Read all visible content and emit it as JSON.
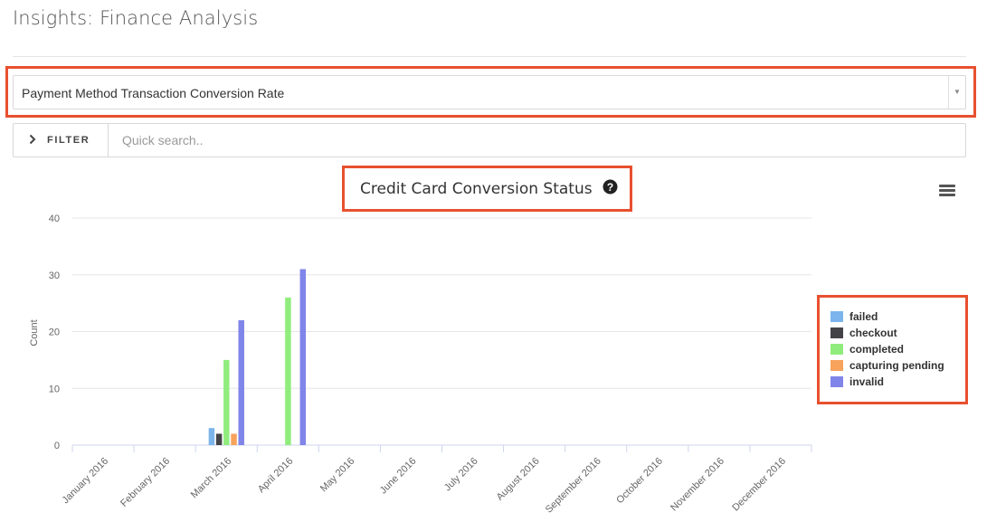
{
  "page": {
    "title": "Insights: Finance Analysis"
  },
  "report_select": {
    "selected": "Payment Method Transaction Conversion Rate"
  },
  "filter_bar": {
    "filter_label": "FILTER",
    "search_placeholder": "Quick search.."
  },
  "icons": {
    "filter_toggle": "chevron-right-icon",
    "help": "question-circle-icon",
    "chart_menu": "hamburger-menu-icon",
    "select_caret": "caret-down-icon"
  },
  "colors": {
    "highlight": "#e8502f"
  },
  "chart_data": {
    "type": "bar",
    "title": "Credit Card Conversion Status",
    "xlabel": "",
    "ylabel": "Count",
    "ylim": [
      0,
      40
    ],
    "yticks": [
      0,
      10,
      20,
      30,
      40
    ],
    "grid": true,
    "legend_position": "right",
    "categories": [
      "January 2016",
      "February 2016",
      "March 2016",
      "April 2016",
      "May 2016",
      "June 2016",
      "July 2016",
      "August 2016",
      "September 2016",
      "October 2016",
      "November 2016",
      "December 2016"
    ],
    "series": [
      {
        "name": "failed",
        "color": "#7cb5ec",
        "values": [
          0,
          0,
          3,
          0,
          0,
          0,
          0,
          0,
          0,
          0,
          0,
          0
        ]
      },
      {
        "name": "checkout",
        "color": "#434348",
        "values": [
          0,
          0,
          2,
          0,
          0,
          0,
          0,
          0,
          0,
          0,
          0,
          0
        ]
      },
      {
        "name": "completed",
        "color": "#90ed7d",
        "values": [
          0,
          0,
          15,
          26,
          0,
          0,
          0,
          0,
          0,
          0,
          0,
          0
        ]
      },
      {
        "name": "capturing pending",
        "color": "#f7a35c",
        "values": [
          0,
          0,
          2,
          0,
          0,
          0,
          0,
          0,
          0,
          0,
          0,
          0
        ]
      },
      {
        "name": "invalid",
        "color": "#8085e9",
        "values": [
          0,
          0,
          22,
          31,
          0,
          0,
          0,
          0,
          0,
          0,
          0,
          0
        ]
      }
    ]
  }
}
